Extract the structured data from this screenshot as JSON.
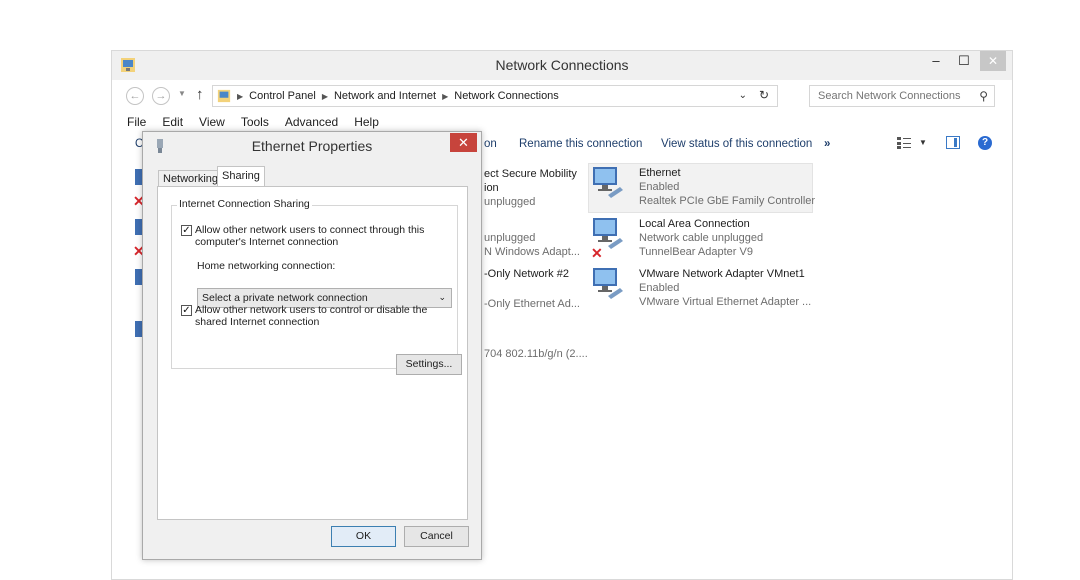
{
  "window": {
    "title": "Network Connections",
    "minimize_label": "–",
    "maximize_label": "☐",
    "close_label": "✕"
  },
  "address_bar": {
    "crumbs": [
      "Control Panel",
      "Network and Internet",
      "Network Connections"
    ],
    "search_placeholder": "Search Network Connections"
  },
  "menu": {
    "items": [
      "File",
      "Edit",
      "View",
      "Tools",
      "Advanced",
      "Help"
    ]
  },
  "command_bar": {
    "organize_partial": "O",
    "connect_partial": "on",
    "rename": "Rename this connection",
    "view_status": "View status of this connection",
    "more": "»"
  },
  "connections": [
    {
      "name": "Ethernet",
      "status": "Enabled",
      "device": "Realtek PCIe GbE Family Controller",
      "selected": true
    },
    {
      "name": "Local Area Connection",
      "status": "Network cable unplugged",
      "device": "TunnelBear Adapter V9",
      "disconnected": true
    },
    {
      "name": "VMware Network Adapter VMnet1",
      "status": "Enabled",
      "device": "VMware Virtual Ethernet Adapter ..."
    }
  ],
  "partial_connections": {
    "c1_line1": "ect Secure Mobility",
    "c1_line2": "ion",
    "c1_line3": "unplugged",
    "c2_line1": "unplugged",
    "c2_line2": "N Windows Adapt...",
    "c3_line1": "-Only Network #2",
    "c3_line2": "-Only Ethernet Ad...",
    "c4_line1": "704 802.11b/g/n (2...."
  },
  "dialog": {
    "title": "Ethernet Properties",
    "close_label": "✕",
    "tabs": [
      "Networking",
      "Sharing"
    ],
    "active_tab": "Sharing",
    "group_title": "Internet Connection Sharing",
    "allow_connect_line1": "Allow other network users to connect through this",
    "allow_connect_line2": "computer's Internet connection",
    "allow_connect_checked": true,
    "home_label": "Home networking connection:",
    "home_select": "Select a private network connection",
    "allow_control_line1": "Allow other network users to control or disable the",
    "allow_control_line2": "shared Internet connection",
    "allow_control_checked": true,
    "settings_button": "Settings...",
    "ok_button": "OK",
    "cancel_button": "Cancel"
  },
  "colors": {
    "accent": "#3a79c6",
    "close_red": "#c7443c",
    "link": "#1e3e6b",
    "error_red": "#d6262c"
  }
}
